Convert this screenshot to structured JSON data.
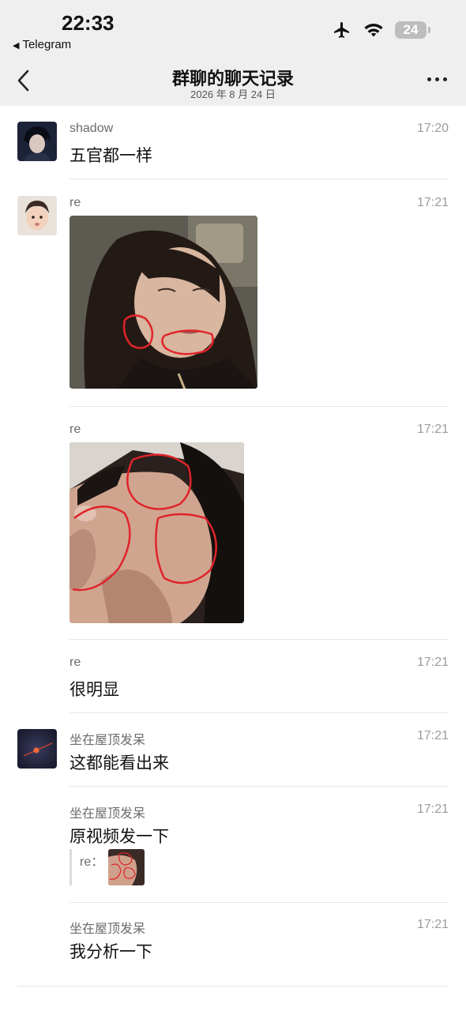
{
  "status_bar": {
    "time": "22:33",
    "back_app": "Telegram",
    "battery": "24"
  },
  "nav": {
    "title": "群聊的聊天记录",
    "date": "2026 年 8 月 24 日"
  },
  "messages": [
    {
      "sender": "shadow",
      "time": "17:20",
      "text": "五官都一样"
    },
    {
      "sender": "re",
      "time": "17:21"
    },
    {
      "sender": "re",
      "time": "17:21"
    },
    {
      "sender": "re",
      "time": "17:21",
      "text": "很明显"
    },
    {
      "sender": "坐在屋顶发呆",
      "time": "17:21",
      "text": "这都能看出来"
    },
    {
      "sender": "坐在屋顶发呆",
      "time": "17:21",
      "text": "原视频发一下",
      "quote_name": "re："
    },
    {
      "sender": "坐在屋顶发呆",
      "time": "17:21",
      "text": "我分析一下"
    }
  ],
  "colors": {
    "annotation_red": "#e0242b",
    "header_bg": "#efefef"
  }
}
